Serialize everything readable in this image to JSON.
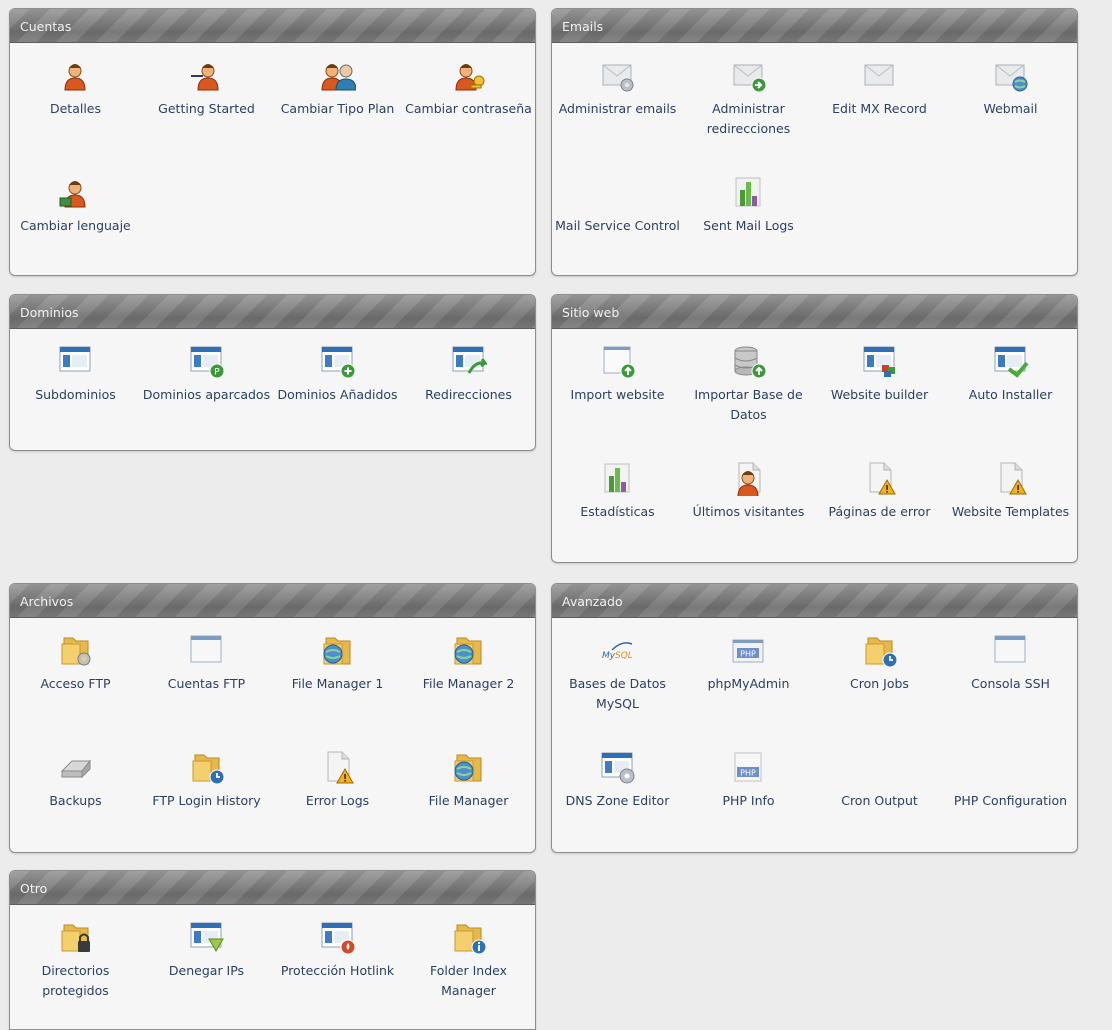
{
  "panels": {
    "cuentas": {
      "title": "Cuentas",
      "items": [
        {
          "label": "Detalles",
          "icon": "person-icon"
        },
        {
          "label": "Getting Started",
          "icon": "person-start-icon"
        },
        {
          "label": "Cambiar Tipo Plan",
          "icon": "people-icon"
        },
        {
          "label": "Cambiar contraseña",
          "icon": "person-key-icon"
        },
        {
          "label": "Cambiar lenguaje",
          "icon": "person-language-icon"
        }
      ]
    },
    "emails": {
      "title": "Emails",
      "items": [
        {
          "label": "Administrar emails",
          "icon": "envelope-gear-icon"
        },
        {
          "label": "Administrar redirecciones",
          "icon": "envelope-arrow-icon"
        },
        {
          "label": "Edit MX Record",
          "icon": "envelope-icon"
        },
        {
          "label": "Webmail",
          "icon": "envelope-globe-icon"
        },
        {
          "label": "Mail Service Control",
          "icon": "blank-icon"
        },
        {
          "label": "Sent Mail Logs",
          "icon": "bar-chart-icon"
        }
      ]
    },
    "dominios": {
      "title": "Dominios",
      "items": [
        {
          "label": "Subdominios",
          "icon": "window-icon"
        },
        {
          "label": "Dominios aparcados",
          "icon": "window-parked-icon"
        },
        {
          "label": "Dominios Añadidos",
          "icon": "window-add-icon"
        },
        {
          "label": "Redirecciones",
          "icon": "window-redirect-icon"
        }
      ]
    },
    "sitio": {
      "title": "Sitio web",
      "items": [
        {
          "label": "Import website",
          "icon": "page-upload-icon"
        },
        {
          "label": "Importar Base de Datos",
          "icon": "database-upload-icon"
        },
        {
          "label": "Website builder",
          "icon": "window-blocks-icon"
        },
        {
          "label": "Auto Installer",
          "icon": "window-install-icon"
        },
        {
          "label": "Estadísticas",
          "icon": "bar-chart-icon"
        },
        {
          "label": "Últimos visitantes",
          "icon": "page-person-icon"
        },
        {
          "label": "Páginas de error",
          "icon": "page-warning-icon"
        },
        {
          "label": "Website Templates",
          "icon": "page-warning-icon"
        }
      ]
    },
    "archivos": {
      "title": "Archivos",
      "items": [
        {
          "label": "Acceso FTP",
          "icon": "folder-gear-icon"
        },
        {
          "label": "Cuentas FTP",
          "icon": "window-blank-icon"
        },
        {
          "label": "File Manager 1",
          "icon": "folder-globe-icon"
        },
        {
          "label": "File Manager 2",
          "icon": "folder-globe-icon"
        },
        {
          "label": "Backups",
          "icon": "disk-icon"
        },
        {
          "label": "FTP Login History",
          "icon": "folder-clock-icon"
        },
        {
          "label": "Error Logs",
          "icon": "page-warning-icon"
        },
        {
          "label": "File Manager",
          "icon": "folder-globe-icon"
        }
      ]
    },
    "avanzado": {
      "title": "Avanzado",
      "items": [
        {
          "label": "Bases de Datos MySQL",
          "icon": "mysql-logo-icon"
        },
        {
          "label": "phpMyAdmin",
          "icon": "php-window-icon"
        },
        {
          "label": "Cron Jobs",
          "icon": "folder-clock-icon"
        },
        {
          "label": "Consola SSH",
          "icon": "window-blank-icon"
        },
        {
          "label": "DNS Zone Editor",
          "icon": "window-gear-icon"
        },
        {
          "label": "PHP Info",
          "icon": "php-page-icon"
        },
        {
          "label": "Cron Output",
          "icon": "blank-icon"
        },
        {
          "label": "PHP Configuration",
          "icon": "blank-icon"
        }
      ]
    },
    "otro": {
      "title": "Otro",
      "items": [
        {
          "label": "Directorios protegidos",
          "icon": "folder-lock-icon"
        },
        {
          "label": "Denegar IPs",
          "icon": "window-shield-icon"
        },
        {
          "label": "Protección Hotlink",
          "icon": "window-fire-icon"
        },
        {
          "label": "Folder Index Manager",
          "icon": "folder-info-icon"
        }
      ]
    }
  }
}
